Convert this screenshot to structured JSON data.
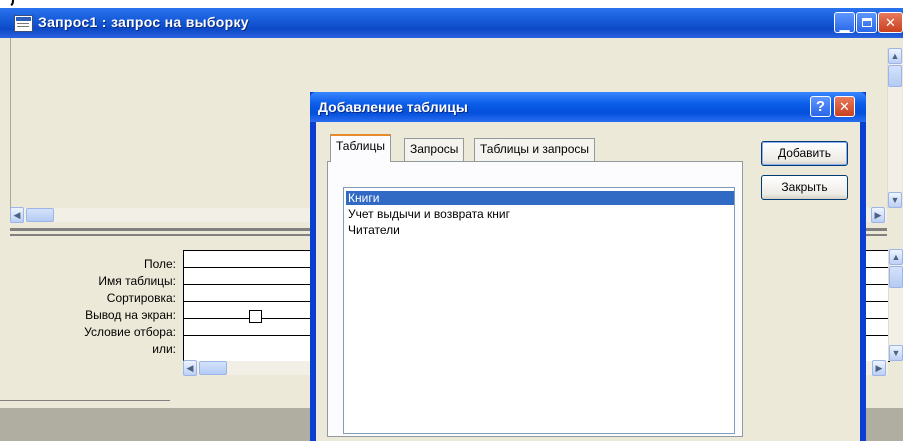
{
  "window": {
    "title": "Запрос1 : запрос на выборку"
  },
  "grid": {
    "row_labels": [
      "Поле:",
      "Имя таблицы:",
      "Сортировка:",
      "Вывод на экран:",
      "Условие отбора:",
      "или:"
    ]
  },
  "dialog": {
    "title": "Добавление таблицы",
    "tabs": [
      "Таблицы",
      "Запросы",
      "Таблицы и запросы"
    ],
    "active_tab": "Таблицы",
    "list_items": [
      "Книги",
      "Учет выдычи и возврата книг",
      "Читатели"
    ],
    "selected_item": "Книги",
    "add_button": "Добавить",
    "close_button": "Закрыть",
    "help_glyph": "?"
  },
  "colors": {
    "title_bar": "#0d49c7",
    "selection": "#316ac5",
    "window_face": "#ece9d8"
  }
}
